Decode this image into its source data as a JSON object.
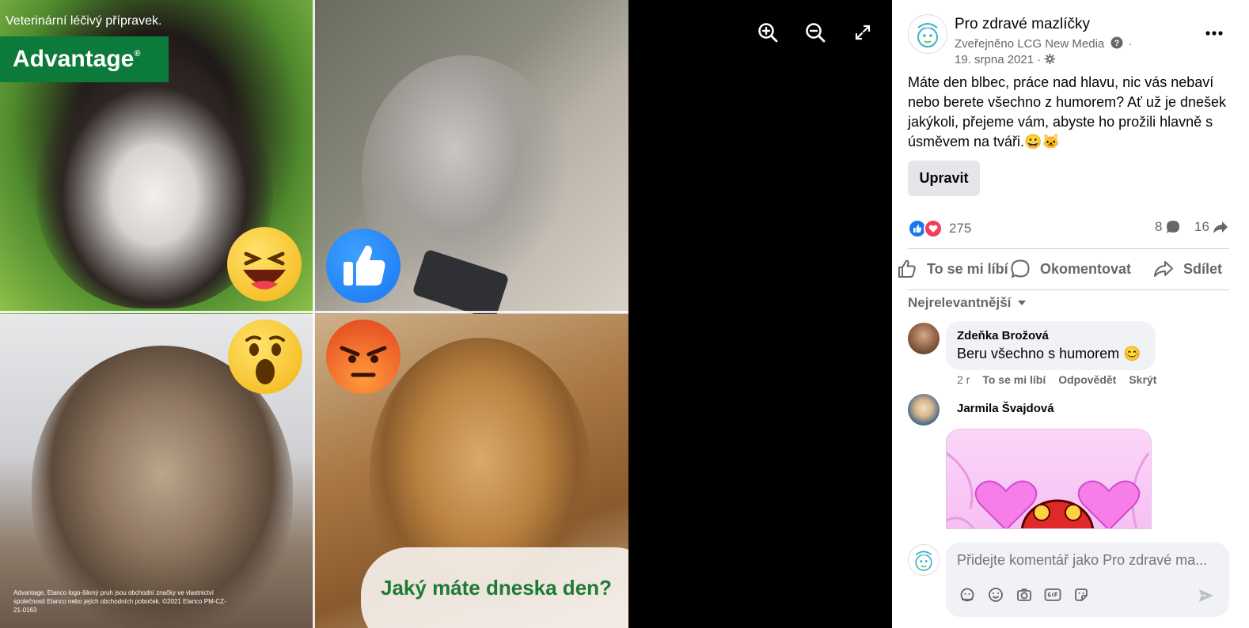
{
  "photo": {
    "vet_text": "Veterinární léčivý přípravek.",
    "brand": "Advantage",
    "brand_mark": "®",
    "headline": "Jaký máte dneska den?",
    "legal": "Advantage, Elanco logo-šikmý pruh jsou obchodní značky ve vlastnictví společnosti Elanco nebo jejích obchodních poboček. ©2021 Elanco PM-CZ-21-0163"
  },
  "viewer_controls": [
    "zoom-in-icon",
    "zoom-out-icon",
    "fullscreen-icon"
  ],
  "post": {
    "page_name": "Pro zdravé mazlíčky",
    "published_by": "Zveřejněno LCG New Media",
    "date": "19. srpna 2021",
    "text": "Máte den blbec, práce nad hlavu, nic vás nebaví nebo berete všechno z humorem? Ať už je dnešek jakýkoli, přejeme vám, abyste ho prožili hlavně s úsměvem na tváři.😀🐱",
    "edit_label": "Upravit",
    "reaction_count": "275",
    "comment_count": "8",
    "share_count": "16"
  },
  "actions": {
    "like": "To se mi líbí",
    "comment": "Okomentovat",
    "share": "Sdílet"
  },
  "sort_label": "Nejrelevantnější",
  "comments": [
    {
      "author": "Zdeňka Brožová",
      "text": "Beru všechno s humorem 😊",
      "time": "2 r",
      "like": "To se mi líbí",
      "reply": "Odpovědět",
      "hide": "Skrýt"
    },
    {
      "author": "Jarmila Švajdová"
    }
  ],
  "composer": {
    "placeholder": "Přidejte komentář jako Pro zdravé ma..."
  },
  "colors": {
    "brand_green": "#0b7a3b",
    "facebook_blue": "#1877f2",
    "text_primary": "#050505",
    "text_secondary": "#65676b"
  }
}
